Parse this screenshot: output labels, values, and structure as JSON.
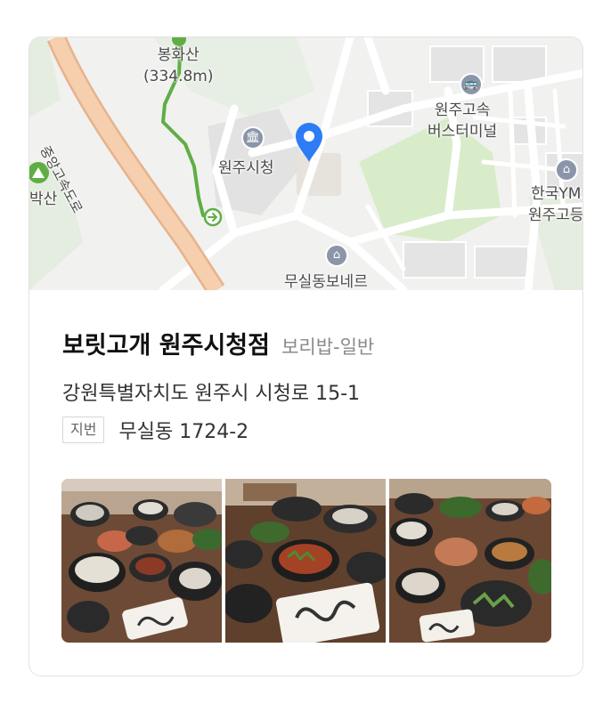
{
  "map": {
    "labels": {
      "mountain_name": "봉화산",
      "mountain_elev": "(334.8m)",
      "highway": "중앙고속도로",
      "left_mountain": "박산",
      "city_hall": "원주시청",
      "terminal_line1": "원주고속",
      "terminal_line2": "버스터미널",
      "ymca_line1": "한국YM",
      "ymca_line2": "원주고등",
      "bottom_place": "무실동보네르"
    },
    "colors": {
      "pin": "#2d7cf6",
      "route": "#5fae45",
      "park": "#d6ecc9",
      "highway": "#f3c7a1",
      "poi": "#8b95a9"
    }
  },
  "place": {
    "name": "보릿고개 원주시청점",
    "category": "보리밥-일반",
    "road_address": "강원특별자치도 원주시 시청로 15-1",
    "jibun_label": "지번",
    "jibun_address": "무실동 1724-2"
  },
  "photos": [
    {
      "icon": "food-photo-1"
    },
    {
      "icon": "food-photo-2"
    },
    {
      "icon": "food-photo-3"
    }
  ]
}
